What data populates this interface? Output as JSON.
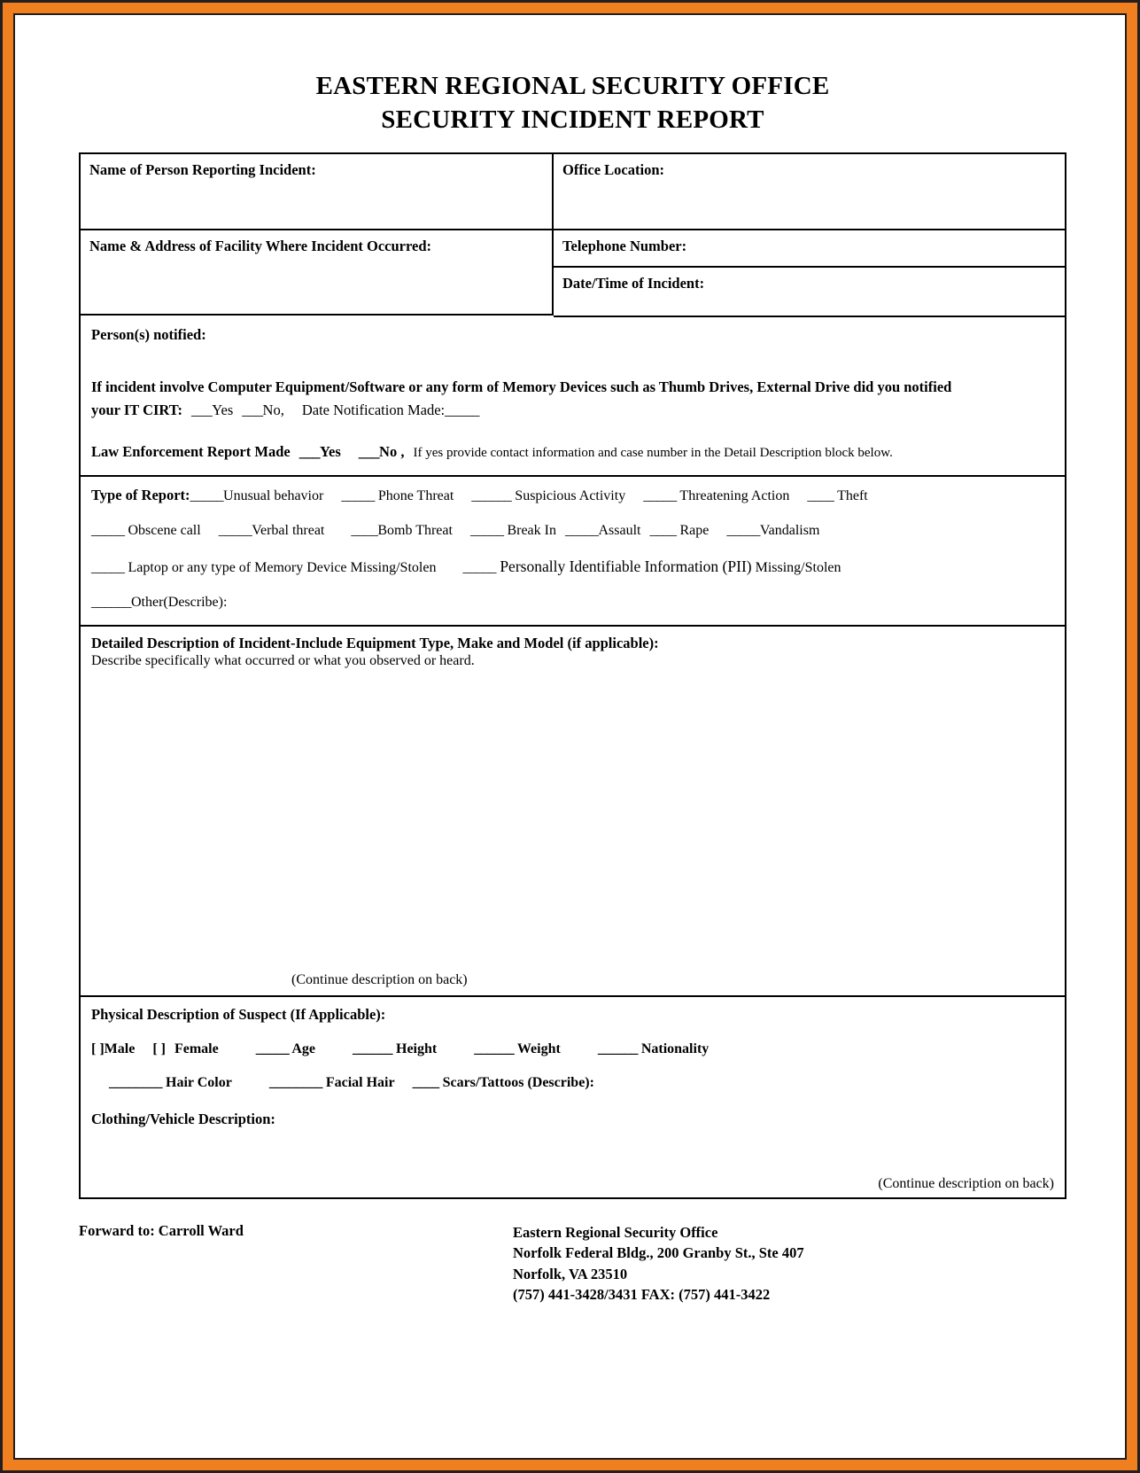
{
  "document": {
    "title_line1": "EASTERN REGIONAL SECURITY OFFICE",
    "title_line2": "SECURITY INCIDENT REPORT"
  },
  "fields": {
    "reporter_name_label": "Name of Person Reporting Incident:",
    "office_location_label": "Office Location:",
    "facility_label": "Name & Address of Facility Where Incident Occurred:",
    "telephone_label": "Telephone Number:",
    "datetime_label": "Date/Time of Incident:",
    "persons_notified_label": "Person(s) notified:"
  },
  "cirt": {
    "question": "If incident involve Computer Equipment/Software or any form of Memory Devices such as Thumb Drives, External Drive did you notified",
    "prefix": "your IT CIRT:",
    "blank_yes": "___",
    "yes": "Yes",
    "blank_no": "___",
    "no": "No,",
    "date_label": "Date Notification Made:",
    "date_blank": "_____"
  },
  "law_enforcement": {
    "label": "Law Enforcement Report Made",
    "blank_yes": "___",
    "yes": "Yes",
    "blank_no": "___",
    "no": "No ,",
    "note": "If yes provide contact information and case number in the Detail Description block below."
  },
  "type_of_report": {
    "heading": "Type of Report:",
    "row1": [
      {
        "blank": "_____",
        "label": "Unusual behavior"
      },
      {
        "blank": "_____",
        "label": " Phone Threat"
      },
      {
        "blank": "______",
        "label": " Suspicious Activity"
      },
      {
        "blank": "_____",
        "label": " Threatening Action"
      },
      {
        "blank": "____",
        "label": " Theft"
      }
    ],
    "row2": [
      {
        "blank": "_____",
        "label": " Obscene call"
      },
      {
        "blank": "_____",
        "label": "Verbal threat"
      },
      {
        "blank": "____",
        "label": "Bomb Threat"
      },
      {
        "blank": "_____",
        "label": " Break In"
      },
      {
        "blank": "_____",
        "label": "Assault"
      },
      {
        "blank": "____",
        "label": " Rape"
      },
      {
        "blank": "_____",
        "label": "Vandalism"
      }
    ],
    "row3_blank1": "_____",
    "row3_label1": " Laptop or any type of Memory Device Missing/Stolen",
    "row3_blank2": "_____",
    "row3_label2a": " Personally Identifiable Information (PII)",
    "row3_label2b": " Missing/Stolen",
    "row4_blank": "______",
    "row4_label": "Other(Describe):"
  },
  "description": {
    "title": "Detailed Description of Incident-Include Equipment Type, Make and Model (if applicable):",
    "subtitle": "Describe specifically what occurred or what you observed or heard.",
    "continue_note": "(Continue description on back)"
  },
  "suspect": {
    "title": "Physical Description of Suspect (If Applicable):",
    "male_box": "[ ]",
    "male_label": "Male",
    "female_box": "[ ]",
    "female_label": "Female",
    "age_blank": "_____",
    "age_label": " Age",
    "height_blank": "______",
    "height_label": " Height",
    "weight_blank": "______",
    "weight_label": " Weight",
    "nationality_blank": "______",
    "nationality_label": " Nationality",
    "hair_blank": "________",
    "hair_label": " Hair Color",
    "facial_blank": "________",
    "facial_label": " Facial Hair",
    "scars_blank": "____",
    "scars_label": " Scars/Tattoos (Describe):",
    "clothing_label": "Clothing/Vehicle Description:",
    "continue_note": "(Continue description on back)"
  },
  "footer": {
    "forward_to": "Forward to: Carroll Ward",
    "office_name": "Eastern Regional Security Office",
    "address_line1": "Norfolk Federal Bldg., 200 Granby St., Ste 407",
    "address_line2": "Norfolk, VA 23510",
    "phone_line": "(757) 441-3428/3431      FAX: (757) 441-3422"
  }
}
